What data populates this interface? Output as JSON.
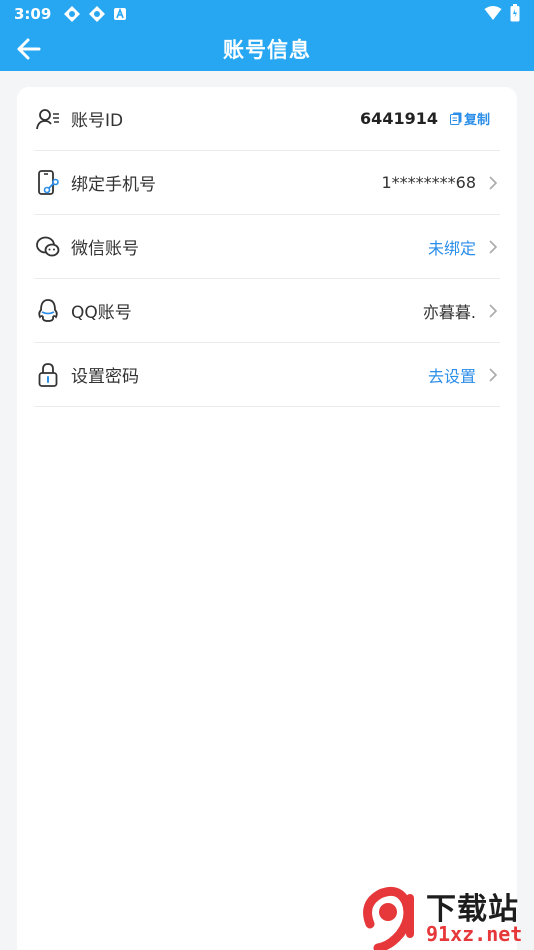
{
  "status_bar": {
    "time": "3:09"
  },
  "header": {
    "title": "账号信息"
  },
  "rows": [
    {
      "label": "账号ID",
      "value": "6441914",
      "action": "复制",
      "icon": "user-list-icon"
    },
    {
      "label": "绑定手机号",
      "value": "1********68",
      "icon": "phone-link-icon"
    },
    {
      "label": "微信账号",
      "value": "未绑定",
      "icon": "wechat-icon"
    },
    {
      "label": "QQ账号",
      "value": "亦暮暮.",
      "icon": "qq-icon"
    },
    {
      "label": "设置密码",
      "value": "去设置",
      "icon": "lock-icon"
    }
  ],
  "colors": {
    "header_bg": "#27a7f2",
    "link_blue": "#2b8ee8",
    "page_bg": "#f4f5f7"
  },
  "watermark": {
    "brand": "下载站",
    "url": "91xz.net"
  }
}
